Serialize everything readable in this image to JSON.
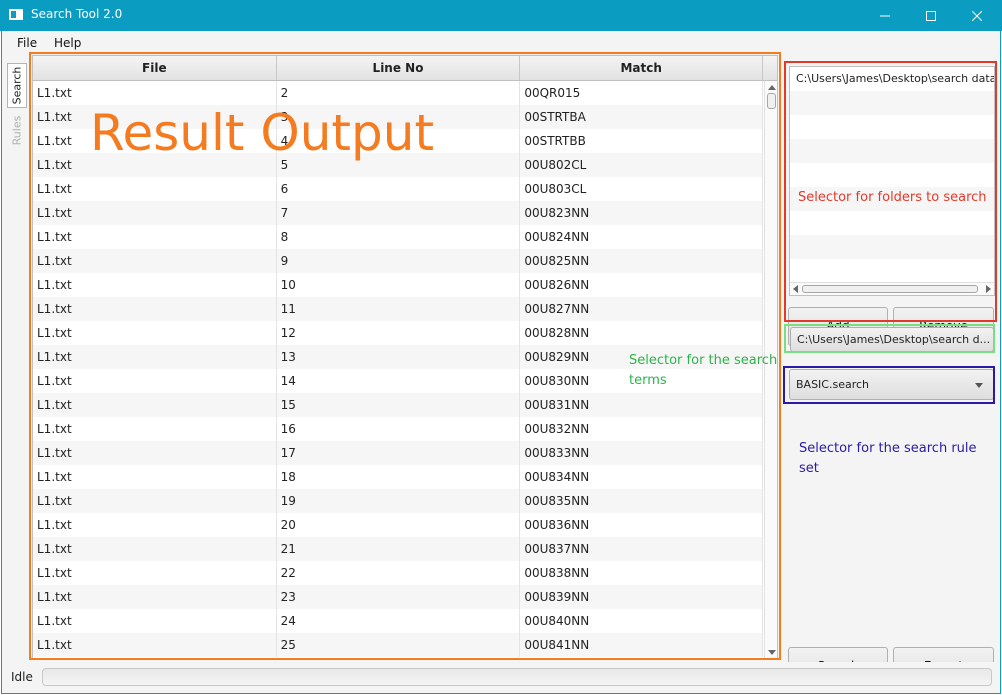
{
  "window": {
    "title": "Search Tool 2.0"
  },
  "menu": {
    "items": [
      "File",
      "Help"
    ]
  },
  "tabs": {
    "search": "Search",
    "rules": "Rules"
  },
  "table": {
    "columns": [
      "File",
      "Line No",
      "Match"
    ],
    "rows": [
      [
        "L1.txt",
        "2",
        "00QR015"
      ],
      [
        "L1.txt",
        "3",
        "00STRTBA"
      ],
      [
        "L1.txt",
        "4",
        "00STRTBB"
      ],
      [
        "L1.txt",
        "5",
        "00U802CL"
      ],
      [
        "L1.txt",
        "6",
        "00U803CL"
      ],
      [
        "L1.txt",
        "7",
        "00U823NN"
      ],
      [
        "L1.txt",
        "8",
        "00U824NN"
      ],
      [
        "L1.txt",
        "9",
        "00U825NN"
      ],
      [
        "L1.txt",
        "10",
        "00U826NN"
      ],
      [
        "L1.txt",
        "11",
        "00U827NN"
      ],
      [
        "L1.txt",
        "12",
        "00U828NN"
      ],
      [
        "L1.txt",
        "13",
        "00U829NN"
      ],
      [
        "L1.txt",
        "14",
        "00U830NN"
      ],
      [
        "L1.txt",
        "15",
        "00U831NN"
      ],
      [
        "L1.txt",
        "16",
        "00U832NN"
      ],
      [
        "L1.txt",
        "17",
        "00U833NN"
      ],
      [
        "L1.txt",
        "18",
        "00U834NN"
      ],
      [
        "L1.txt",
        "19",
        "00U835NN"
      ],
      [
        "L1.txt",
        "20",
        "00U836NN"
      ],
      [
        "L1.txt",
        "21",
        "00U837NN"
      ],
      [
        "L1.txt",
        "22",
        "00U838NN"
      ],
      [
        "L1.txt",
        "23",
        "00U839NN"
      ],
      [
        "L1.txt",
        "24",
        "00U840NN"
      ],
      [
        "L1.txt",
        "25",
        "00U841NN"
      ]
    ]
  },
  "annotations": {
    "result": "Result Output",
    "folders": "Selector for folders to search",
    "terms": "Selector for the search terms",
    "rules": "Selector for the search rule set"
  },
  "folders": {
    "items": [
      "C:\\Users\\James\\Desktop\\search data",
      "",
      "",
      "",
      "",
      "",
      "",
      ""
    ]
  },
  "buttons": {
    "add": "Add",
    "remove": "Remove",
    "search": "Search",
    "export": "Export"
  },
  "search_terms": {
    "value": "C:\\Users\\James\\Desktop\\search d..."
  },
  "rule_set": {
    "selected": "BASIC.search"
  },
  "status": {
    "text": "Idle"
  },
  "colors": {
    "titlebar": "#0b9cc2",
    "result": "#f47b20",
    "folders": "#e23a2a",
    "terms": "#2db34a",
    "rules": "#2a1aa8"
  }
}
